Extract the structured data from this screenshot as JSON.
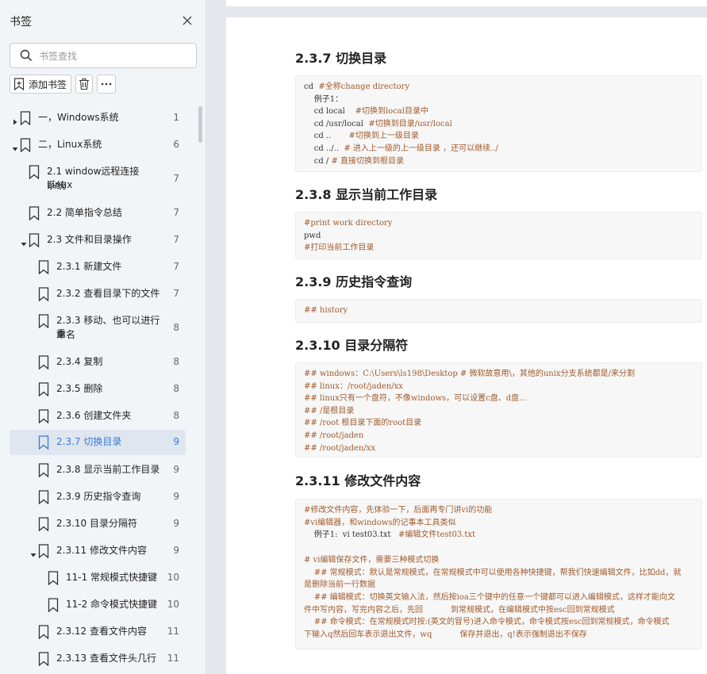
{
  "sidebar": {
    "title": "书签",
    "search_placeholder": "书签查找",
    "add_label": "添加书签",
    "items": [
      {
        "label": "一，Windows系统",
        "page": "1"
      },
      {
        "label": "二，Linux系统",
        "page": "6"
      },
      {
        "label": "2.1 window远程连接Linux",
        "label2": "系统",
        "page": "7"
      },
      {
        "label": "2.2 简单指令总结",
        "page": "7"
      },
      {
        "label": "2.3 文件和目录操作",
        "page": "7"
      },
      {
        "label": "2.3.1 新建文件",
        "page": "7"
      },
      {
        "label": "2.3.2 查看目录下的文件",
        "page": "7"
      },
      {
        "label": "2.3.3 移动、也可以进行重",
        "label2": "命名",
        "page": "8"
      },
      {
        "label": "2.3.4 复制",
        "page": "8"
      },
      {
        "label": "2.3.5 删除",
        "page": "8"
      },
      {
        "label": "2.3.6 创建文件夹",
        "page": "8"
      },
      {
        "label": "2.3.7 切换目录",
        "page": "9"
      },
      {
        "label": "2.3.8 显示当前工作目录",
        "page": "9"
      },
      {
        "label": "2.3.9 历史指令查询",
        "page": "9"
      },
      {
        "label": "2.3.10 目录分隔符",
        "page": "9"
      },
      {
        "label": "2.3.11 修改文件内容",
        "page": "9"
      },
      {
        "label": "11-1 常规模式快捷键",
        "page": "10"
      },
      {
        "label": "11-2 命令模式快捷键",
        "page": "10"
      },
      {
        "label": "2.3.12 查看文件内容",
        "page": "11"
      },
      {
        "label": "2.3.13 查看文件头几行",
        "page": "11"
      }
    ]
  },
  "doc": {
    "sections": [
      {
        "heading": "2.3.7 切换目录",
        "lines": [
          {
            "cmd": "cd  ",
            "cmt": "#全称change directory"
          },
          {
            "cmd": "    例子1：",
            "cmt": ""
          },
          {
            "cmd": "    cd local    ",
            "cmt": "#切换到local目录中"
          },
          {
            "cmd": "    cd /usr/local  ",
            "cmt": "#切换到目录/usr/local"
          },
          {
            "cmd": "    cd ..       ",
            "cmt": "#切换到上一级目录"
          },
          {
            "cmd": "    cd ../..  ",
            "cmt": "# 进入上一级的上一级目录 ，还可以继续../"
          },
          {
            "cmd": "    cd / ",
            "cmt": "# 直接切换到根目录"
          }
        ]
      },
      {
        "heading": "2.3.8 显示当前工作目录",
        "lines": [
          {
            "cmd": "",
            "cmt": "#print work directory"
          },
          {
            "cmd": "pwd",
            "cmt": ""
          },
          {
            "cmd": "",
            "cmt": "#打印当前工作目录"
          }
        ]
      },
      {
        "heading": "2.3.9 历史指令查询",
        "lines": [
          {
            "cmd": "",
            "cmt": "## history"
          }
        ]
      },
      {
        "heading": "2.3.10 目录分隔符",
        "lines": [
          {
            "cmd": "",
            "cmt": "## windows：C:\\Users\\ls198\\Desktop # 微软故意用\\，其他的unix分支系统都是/来分割"
          },
          {
            "cmd": "",
            "cmt": "## linux：/root/jaden/xx"
          },
          {
            "cmd": "",
            "cmt": "## linux只有一个盘符，不像windows，可以设置c盘、d盘..."
          },
          {
            "cmd": "",
            "cmt": "## /是根目录"
          },
          {
            "cmd": "",
            "cmt": "## /root 根目录下面的root目录"
          },
          {
            "cmd": "",
            "cmt": "## /root/jaden"
          },
          {
            "cmd": "",
            "cmt": "## /root/jaden/xx"
          }
        ]
      },
      {
        "heading": "2.3.11 修改文件内容",
        "lines": [
          {
            "cmd": "",
            "cmt": "#修改文件内容，先体验一下，后面再专门讲vi的功能"
          },
          {
            "cmd": "",
            "cmt": "#vi编辑器，和windows的记事本工具类似"
          },
          {
            "cmd": "    例子1:  vi test03.txt   ",
            "cmt": "#编辑文件test03.txt"
          },
          {
            "cmd": "",
            "cmt": ""
          },
          {
            "cmd": "",
            "cmt": "# vi编辑保存文件，需要三种模式切换"
          },
          {
            "cmd": "",
            "cmt": "    ## 常规模式：默认是常规模式，在常规模式中可以使用各种快捷键，帮我们快速编辑文件，比如dd，就"
          },
          {
            "cmd": "",
            "cmt": "是删除当前一行数据"
          },
          {
            "cmd": "",
            "cmt": "    ## 编辑模式：切换英文输入法，然后按ioa三个键中的任意一个键都可以进入编辑模式，这样才能向文"
          },
          {
            "cmd": "",
            "cmt": "件中写内容，写完内容之后，先回           到常规模式，在编辑模式中按esc回到常规模式"
          },
          {
            "cmd": "",
            "cmt": "    ## 命令模式：在常规模式时按:(英文的冒号)进入命令模式，命令模式按esc回到常规模式，命令模式"
          },
          {
            "cmd": "",
            "cmt": "下输入q然后回车表示退出文件，wq           保存并退出，q!表示强制退出不保存"
          }
        ]
      }
    ]
  }
}
